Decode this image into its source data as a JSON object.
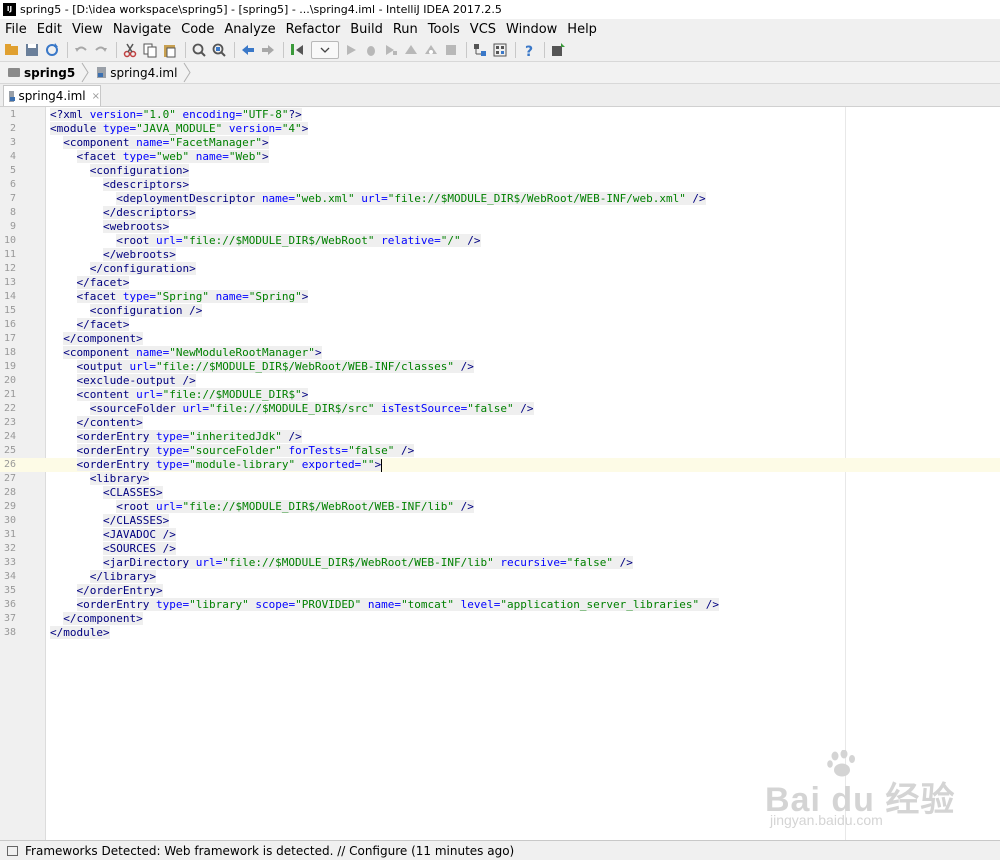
{
  "window": {
    "title": "spring5 - [D:\\idea workspace\\spring5] - [spring5] - ...\\spring4.iml - IntelliJ IDEA 2017.2.5",
    "logo_text": "IJ"
  },
  "menu": [
    "File",
    "Edit",
    "View",
    "Navigate",
    "Code",
    "Analyze",
    "Refactor",
    "Build",
    "Run",
    "Tools",
    "VCS",
    "Window",
    "Help"
  ],
  "toolbar": {
    "icons": [
      "open-folder-icon",
      "save-icon",
      "sync-icon",
      "undo-icon",
      "redo-icon",
      "cut-icon",
      "copy-icon",
      "paste-icon",
      "find-icon",
      "replace-icon",
      "back-icon",
      "forward-icon",
      "build-icon",
      "run-config-dropdown",
      "run-icon",
      "debug-icon",
      "coverage-icon",
      "profile-icon",
      "attach-icon",
      "stop-icon",
      "project-structure-icon",
      "sdk-icon",
      "help-icon",
      "update-icon"
    ]
  },
  "breadcrumbs": [
    {
      "label": "spring5",
      "icon": "folder-icon"
    },
    {
      "label": "spring4.iml",
      "icon": "iml-file-icon"
    }
  ],
  "tabs": [
    {
      "label": "spring4.iml",
      "close": "×"
    }
  ],
  "editor": {
    "current_line": 26,
    "lines": [
      [
        [
          "prolog",
          "<?"
        ],
        [
          "tag",
          "xml "
        ],
        [
          "attr",
          "version="
        ],
        [
          "val",
          "\"1.0\""
        ],
        [
          "attr",
          " encoding="
        ],
        [
          "val",
          "\"UTF-8\""
        ],
        [
          "prolog",
          "?>"
        ]
      ],
      [
        [
          "tag",
          "<module "
        ],
        [
          "attr",
          "type="
        ],
        [
          "val",
          "\"JAVA_MODULE\""
        ],
        [
          "attr",
          " version="
        ],
        [
          "val",
          "\"4\""
        ],
        [
          "tag",
          ">"
        ]
      ],
      [
        [
          "sp",
          "  "
        ],
        [
          "tag",
          "<component "
        ],
        [
          "attr",
          "name="
        ],
        [
          "val",
          "\"FacetManager\""
        ],
        [
          "tag",
          ">"
        ]
      ],
      [
        [
          "sp",
          "    "
        ],
        [
          "tag",
          "<facet "
        ],
        [
          "attr",
          "type="
        ],
        [
          "val",
          "\"web\""
        ],
        [
          "attr",
          " name="
        ],
        [
          "val",
          "\"Web\""
        ],
        [
          "tag",
          ">"
        ]
      ],
      [
        [
          "sp",
          "      "
        ],
        [
          "tag",
          "<configuration>"
        ]
      ],
      [
        [
          "sp",
          "        "
        ],
        [
          "tag",
          "<descriptors>"
        ]
      ],
      [
        [
          "sp",
          "          "
        ],
        [
          "tag",
          "<deploymentDescriptor "
        ],
        [
          "attr",
          "name="
        ],
        [
          "val",
          "\"web.xml\""
        ],
        [
          "attr",
          " url="
        ],
        [
          "val",
          "\"file://$MODULE_DIR$/WebRoot/WEB-INF/web.xml\""
        ],
        [
          "tag",
          " />"
        ]
      ],
      [
        [
          "sp",
          "        "
        ],
        [
          "tag",
          "</descriptors>"
        ]
      ],
      [
        [
          "sp",
          "        "
        ],
        [
          "tag",
          "<webroots>"
        ]
      ],
      [
        [
          "sp",
          "          "
        ],
        [
          "tag",
          "<root "
        ],
        [
          "attr",
          "url="
        ],
        [
          "val",
          "\"file://$MODULE_DIR$/WebRoot\""
        ],
        [
          "attr",
          " relative="
        ],
        [
          "val",
          "\"/\""
        ],
        [
          "tag",
          " />"
        ]
      ],
      [
        [
          "sp",
          "        "
        ],
        [
          "tag",
          "</webroots>"
        ]
      ],
      [
        [
          "sp",
          "      "
        ],
        [
          "tag",
          "</configuration>"
        ]
      ],
      [
        [
          "sp",
          "    "
        ],
        [
          "tag",
          "</facet>"
        ]
      ],
      [
        [
          "sp",
          "    "
        ],
        [
          "tag",
          "<facet "
        ],
        [
          "attr",
          "type="
        ],
        [
          "val",
          "\"Spring\""
        ],
        [
          "attr",
          " name="
        ],
        [
          "val",
          "\"Spring\""
        ],
        [
          "tag",
          ">"
        ]
      ],
      [
        [
          "sp",
          "      "
        ],
        [
          "tag",
          "<configuration />"
        ]
      ],
      [
        [
          "sp",
          "    "
        ],
        [
          "tag",
          "</facet>"
        ]
      ],
      [
        [
          "sp",
          "  "
        ],
        [
          "tag",
          "</component>"
        ]
      ],
      [
        [
          "sp",
          "  "
        ],
        [
          "tag",
          "<component "
        ],
        [
          "attr",
          "name="
        ],
        [
          "val",
          "\"NewModuleRootManager\""
        ],
        [
          "tag",
          ">"
        ]
      ],
      [
        [
          "sp",
          "    "
        ],
        [
          "tag",
          "<output "
        ],
        [
          "attr",
          "url="
        ],
        [
          "val",
          "\"file://$MODULE_DIR$/WebRoot/WEB-INF/classes\""
        ],
        [
          "tag",
          " />"
        ]
      ],
      [
        [
          "sp",
          "    "
        ],
        [
          "tag",
          "<exclude-output />"
        ]
      ],
      [
        [
          "sp",
          "    "
        ],
        [
          "tag",
          "<content "
        ],
        [
          "attr",
          "url="
        ],
        [
          "val",
          "\"file://$MODULE_DIR$\""
        ],
        [
          "tag",
          ">"
        ]
      ],
      [
        [
          "sp",
          "      "
        ],
        [
          "tag",
          "<sourceFolder "
        ],
        [
          "attr",
          "url="
        ],
        [
          "val",
          "\"file://$MODULE_DIR$/src\""
        ],
        [
          "attr",
          " isTestSource="
        ],
        [
          "val",
          "\"false\""
        ],
        [
          "tag",
          " />"
        ]
      ],
      [
        [
          "sp",
          "    "
        ],
        [
          "tag",
          "</content>"
        ]
      ],
      [
        [
          "sp",
          "    "
        ],
        [
          "tag",
          "<orderEntry "
        ],
        [
          "attr",
          "type="
        ],
        [
          "val",
          "\"inheritedJdk\""
        ],
        [
          "tag",
          " />"
        ]
      ],
      [
        [
          "sp",
          "    "
        ],
        [
          "tag",
          "<orderEntry "
        ],
        [
          "attr",
          "type="
        ],
        [
          "val",
          "\"sourceFolder\""
        ],
        [
          "attr",
          " forTests="
        ],
        [
          "val",
          "\"false\""
        ],
        [
          "tag",
          " />"
        ]
      ],
      [
        [
          "sp",
          "    "
        ],
        [
          "tag",
          "<orderEntry "
        ],
        [
          "attr",
          "type="
        ],
        [
          "val",
          "\"module-library\""
        ],
        [
          "attr",
          " exported="
        ],
        [
          "val",
          "\"\""
        ],
        [
          "tag",
          ">"
        ]
      ],
      [
        [
          "sp",
          "      "
        ],
        [
          "tag",
          "<library>"
        ]
      ],
      [
        [
          "sp",
          "        "
        ],
        [
          "tag",
          "<CLASSES>"
        ]
      ],
      [
        [
          "sp",
          "          "
        ],
        [
          "tag",
          "<root "
        ],
        [
          "attr",
          "url="
        ],
        [
          "val",
          "\"file://$MODULE_DIR$/WebRoot/WEB-INF/lib\""
        ],
        [
          "tag",
          " />"
        ]
      ],
      [
        [
          "sp",
          "        "
        ],
        [
          "tag",
          "</CLASSES>"
        ]
      ],
      [
        [
          "sp",
          "        "
        ],
        [
          "tag",
          "<JAVADOC />"
        ]
      ],
      [
        [
          "sp",
          "        "
        ],
        [
          "tag",
          "<SOURCES />"
        ]
      ],
      [
        [
          "sp",
          "        "
        ],
        [
          "tag",
          "<jarDirectory "
        ],
        [
          "attr",
          "url="
        ],
        [
          "val",
          "\"file://$MODULE_DIR$/WebRoot/WEB-INF/lib\""
        ],
        [
          "attr",
          " recursive="
        ],
        [
          "val",
          "\"false\""
        ],
        [
          "tag",
          " />"
        ]
      ],
      [
        [
          "sp",
          "      "
        ],
        [
          "tag",
          "</library>"
        ]
      ],
      [
        [
          "sp",
          "    "
        ],
        [
          "tag",
          "</orderEntry>"
        ]
      ],
      [
        [
          "sp",
          "    "
        ],
        [
          "tag",
          "<orderEntry "
        ],
        [
          "attr",
          "type="
        ],
        [
          "val",
          "\"library\""
        ],
        [
          "attr",
          " scope="
        ],
        [
          "val",
          "\"PROVIDED\""
        ],
        [
          "attr",
          " name="
        ],
        [
          "val",
          "\"tomcat\""
        ],
        [
          "attr",
          " level="
        ],
        [
          "val",
          "\"application_server_libraries\""
        ],
        [
          "tag",
          " />"
        ]
      ],
      [
        [
          "sp",
          "  "
        ],
        [
          "tag",
          "</component>"
        ]
      ],
      [
        [
          "tag",
          "</module>"
        ]
      ]
    ]
  },
  "status": {
    "text": "Frameworks Detected: Web framework is detected. // Configure (11 minutes ago)"
  },
  "watermark": {
    "brand": "Bai du 经验",
    "url": "jingyan.baidu.com"
  },
  "colors": {
    "tag": "#000080",
    "attr": "#0000ff",
    "value": "#008000",
    "current_line": "#fdfbe6",
    "gutter": "#f0f0f0"
  }
}
